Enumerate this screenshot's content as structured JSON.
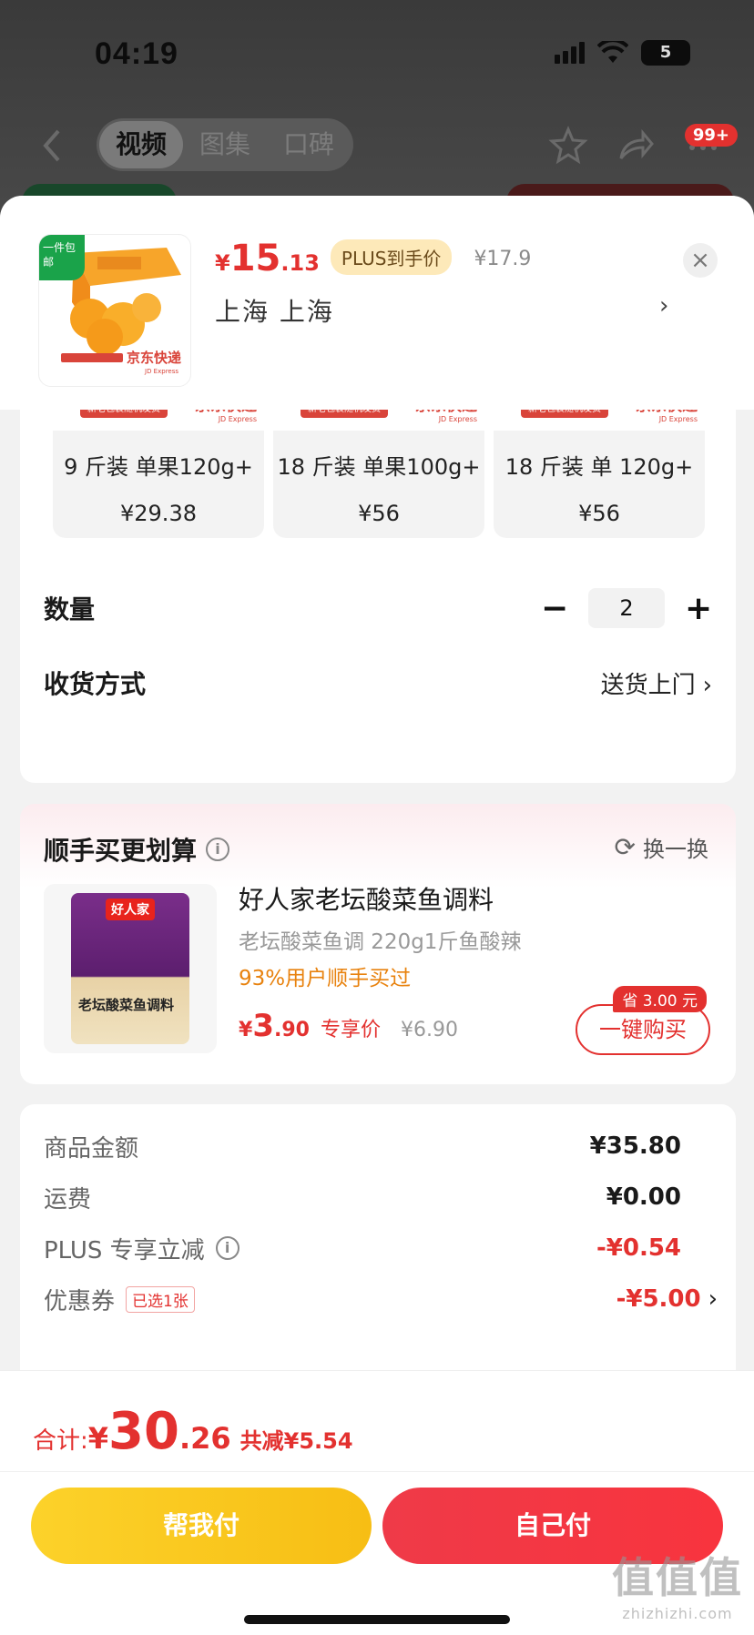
{
  "status": {
    "time": "04:19",
    "battery": "5"
  },
  "nav": {
    "tabs": [
      {
        "label": "视频"
      },
      {
        "label": "图集"
      },
      {
        "label": "口碑"
      }
    ],
    "badge": "99+"
  },
  "header": {
    "thumb_tag": "一件包邮",
    "price_symbol": "¥",
    "price_int": "15",
    "price_dec": ".13",
    "plus_label": "PLUS到手价",
    "orig_price": "¥17.9",
    "address": "上海  上海",
    "close": "×"
  },
  "specs": [
    {
      "name": "9 斤装 单果120g+",
      "price": "¥29.38",
      "pack_label": "新老包装随机发货",
      "brand": "京东快递",
      "brand_en": "JD Express"
    },
    {
      "name": "18 斤装 单果100g+",
      "price": "¥56",
      "pack_label": "新老包装随机发货",
      "brand": "京东快递",
      "brand_en": "JD Express"
    },
    {
      "name": "18 斤装 单 120g+",
      "price": "¥56",
      "pack_label": "新老包装随机发货",
      "brand": "京东快递",
      "brand_en": "JD Express"
    }
  ],
  "quantity": {
    "label": "数量",
    "minus": "−",
    "value": "2",
    "plus": "+"
  },
  "shipping": {
    "label": "收货方式",
    "value": "送货上门"
  },
  "bundle": {
    "title": "顺手买更划算",
    "swap": "换一换",
    "product_name": "好人家老坛酸菜鱼调料",
    "product_sub": "老坛酸菜鱼调 220g1斤鱼酸辣",
    "social": "93%用户顺手买过",
    "pack_logo": "好人家",
    "pack_text": "老坛酸菜鱼调料",
    "price_symbol": "¥",
    "price_int": "3",
    "price_dec": ".90",
    "price_tag": "专享价",
    "orig_price": "¥6.90",
    "save_tag": "省 3.00 元",
    "buy_label": "一键购买"
  },
  "fees": [
    {
      "label": "商品金额",
      "value": "¥35.80",
      "red": false
    },
    {
      "label": "运费",
      "value": "¥0.00",
      "red": false
    },
    {
      "label": "PLUS 专享立减",
      "value": "-¥0.54",
      "red": true
    },
    {
      "label": "优惠券",
      "value": "-¥5.00",
      "red": true,
      "tag": "已选1张"
    }
  ],
  "footer": {
    "total_label": "合计:",
    "total_symbol": "¥",
    "total_int": "30",
    "total_dec": ".26",
    "saved": "共减¥5.54",
    "btn_help": "帮我付",
    "btn_self": "自己付"
  },
  "watermark": {
    "big": "值值值",
    "small": "zhizhizhi.com"
  },
  "colors": {
    "accent_red": "#e3312f",
    "accent_yellow": "#fcd22a",
    "social_orange": "#e8820e",
    "green_tag": "#1aa34a"
  }
}
